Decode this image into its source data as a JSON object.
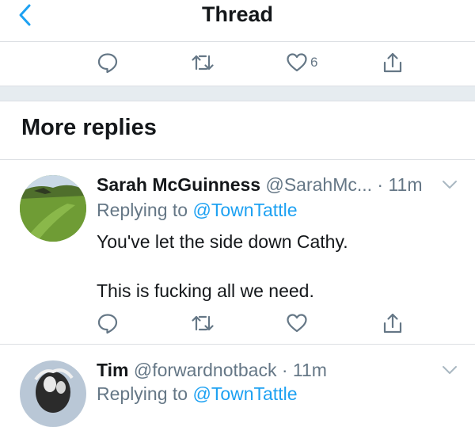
{
  "header": {
    "title": "Thread"
  },
  "main_tweet_actions": {
    "like_count": "6"
  },
  "section": {
    "title": "More replies"
  },
  "tweets": [
    {
      "name": "Sarah McGuinness",
      "handle": "@SarahMc...",
      "time": "· 11m",
      "replying_prefix": "Replying to",
      "replying_to": "@TownTattle",
      "text_line1": "You've let the side down Cathy.",
      "text_line2": "This is fucking all we need."
    },
    {
      "name": "Tim",
      "handle": "@forwardnotback",
      "time": "· 11m",
      "replying_prefix": "Replying to",
      "replying_to": "@TownTattle"
    }
  ],
  "colors": {
    "accent": "#1da1f2",
    "secondary_text": "#657786",
    "divider": "#dcdfe3",
    "icon": "#657786"
  }
}
